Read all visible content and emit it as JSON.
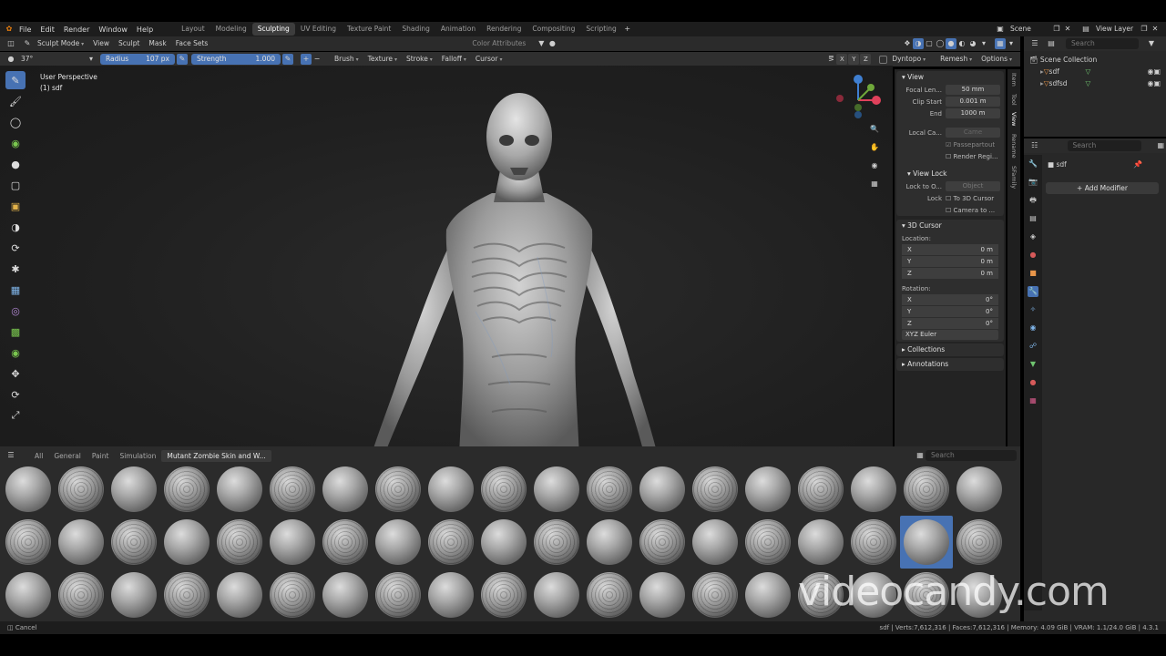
{
  "menu": [
    "File",
    "Edit",
    "Render",
    "Window",
    "Help"
  ],
  "workspaces": [
    "Layout",
    "Modeling",
    "Sculpting",
    "UV Editing",
    "Texture Paint",
    "Shading",
    "Animation",
    "Rendering",
    "Compositing",
    "Scripting"
  ],
  "active_workspace_index": 2,
  "scene_name": "Scene",
  "view_layer": "View Layer",
  "mode": "Sculpt Mode",
  "header_menus": [
    "View",
    "Sculpt",
    "Mask",
    "Face Sets"
  ],
  "color_attributes": "Color Attributes",
  "tool_settings": {
    "angle": "37°",
    "radius_label": "Radius",
    "radius_value": "107 px",
    "strength_label": "Strength",
    "strength_value": "1.000",
    "menus": [
      "Brush",
      "Texture",
      "Stroke",
      "Falloff",
      "Cursor"
    ],
    "xyz": [
      "X",
      "Y",
      "Z"
    ],
    "dyntopo": "Dyntopo",
    "remesh": "Remesh",
    "options": "Options"
  },
  "viewport": {
    "perspective": "User Perspective",
    "object": "(1) sdf"
  },
  "npanel": {
    "view_title": "View",
    "focal_label": "Focal Len...",
    "focal_value": "50 mm",
    "clip_start_label": "Clip Start",
    "clip_start_value": "0.001 m",
    "end_label": "End",
    "end_value": "1000 m",
    "local_camera_label": "Local Ca...",
    "local_camera_value": "Came",
    "passepartout": "Passepartout",
    "render_region": "Render Regi...",
    "view_lock_title": "View Lock",
    "lock_to_label": "Lock to O...",
    "lock_to_value": "Object",
    "lock_label": "Lock",
    "to_3d_cursor": "To 3D Cursor",
    "camera_to": "Camera to ...",
    "cursor_title": "3D Cursor",
    "location_label": "Location:",
    "loc": [
      {
        "axis": "X",
        "value": "0 m"
      },
      {
        "axis": "Y",
        "value": "0 m"
      },
      {
        "axis": "Z",
        "value": "0 m"
      }
    ],
    "rotation_label": "Rotation:",
    "rot": [
      {
        "axis": "X",
        "value": "0°"
      },
      {
        "axis": "Y",
        "value": "0°"
      },
      {
        "axis": "Z",
        "value": "0°"
      }
    ],
    "rotation_mode": "XYZ Euler",
    "collections": "Collections",
    "annotations": "Annotations",
    "tabs": [
      "Item",
      "Tool",
      "View",
      "Rename",
      "SFamily"
    ]
  },
  "outliner": {
    "search_placeholder": "Search",
    "root": "Scene Collection",
    "items": [
      "sdf",
      "sdfsd"
    ]
  },
  "properties": {
    "search_placeholder": "Search",
    "object": "sdf",
    "add_modifier": "Add Modifier"
  },
  "assets": {
    "categories": [
      "All",
      "General",
      "Paint",
      "Simulation",
      "Mutant Zombie Skin and W..."
    ],
    "active_category_index": 4,
    "search_placeholder": "Search"
  },
  "status": {
    "left": "Cancel",
    "right": "sdf | Verts:7,612,316 | Faces:7,612,316 | Memory: 4.09 GiB | VRAM: 1.1/24.0 GiB | 4.3.1"
  },
  "watermark": "videocandy.com",
  "colors": {
    "accent": "#4772b3",
    "x_axis": "#e0415b",
    "y_axis": "#6fa83a",
    "z_axis": "#3f7fd1"
  }
}
